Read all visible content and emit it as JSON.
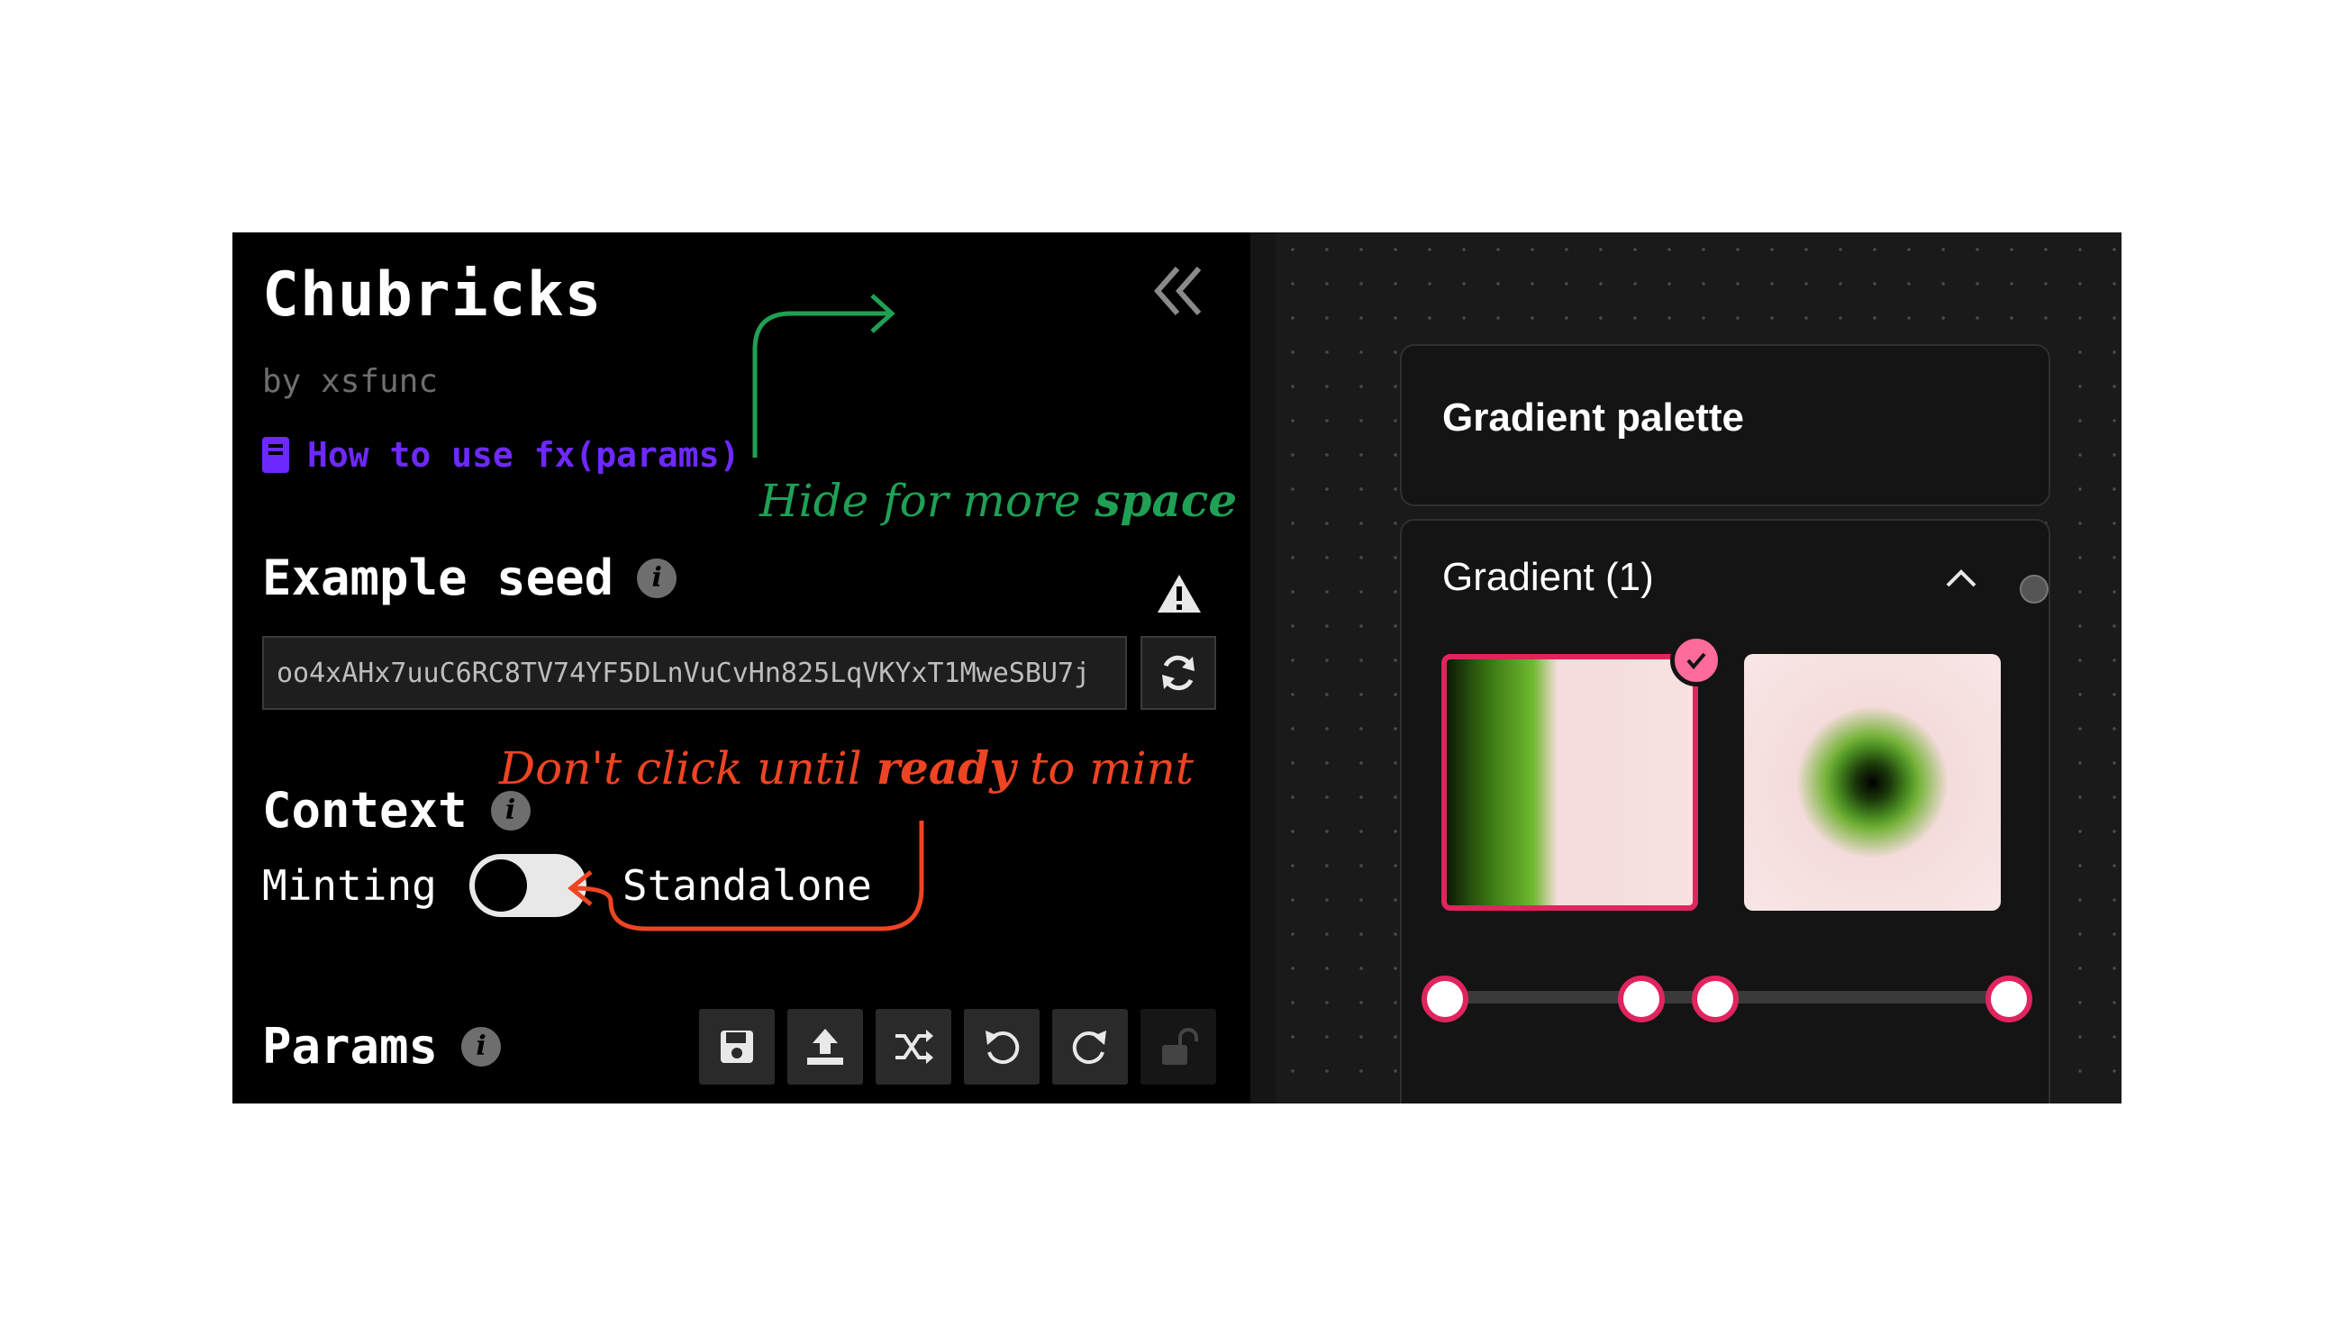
{
  "sidebar": {
    "title": "Chubricks",
    "author": "by xsfunc",
    "howto_link": "How to use fx(params)",
    "seed_section": {
      "title": "Example seed",
      "value": "oo4xAHx7uuC6RC8TV74YF5DLnVuCvHn825LqVKYxT1MweSBU7j"
    },
    "context_section": {
      "title": "Context",
      "left_label": "Minting",
      "right_label": "Standalone",
      "toggle_on": false
    },
    "params_section": {
      "title": "Params",
      "tools": [
        "save-icon",
        "upload-icon",
        "shuffle-icon",
        "undo-icon",
        "redo-icon",
        "lock-icon"
      ]
    }
  },
  "annotations": {
    "hide": {
      "pre": "Hide for more ",
      "em": "space"
    },
    "mint": {
      "pre": "Don't click until ",
      "em": "ready",
      "post": " to mint"
    }
  },
  "editor": {
    "palette_title": "Gradient palette",
    "gradient_title": "Gradient (1)",
    "stops_count": 4,
    "accent": "#e0245e"
  }
}
